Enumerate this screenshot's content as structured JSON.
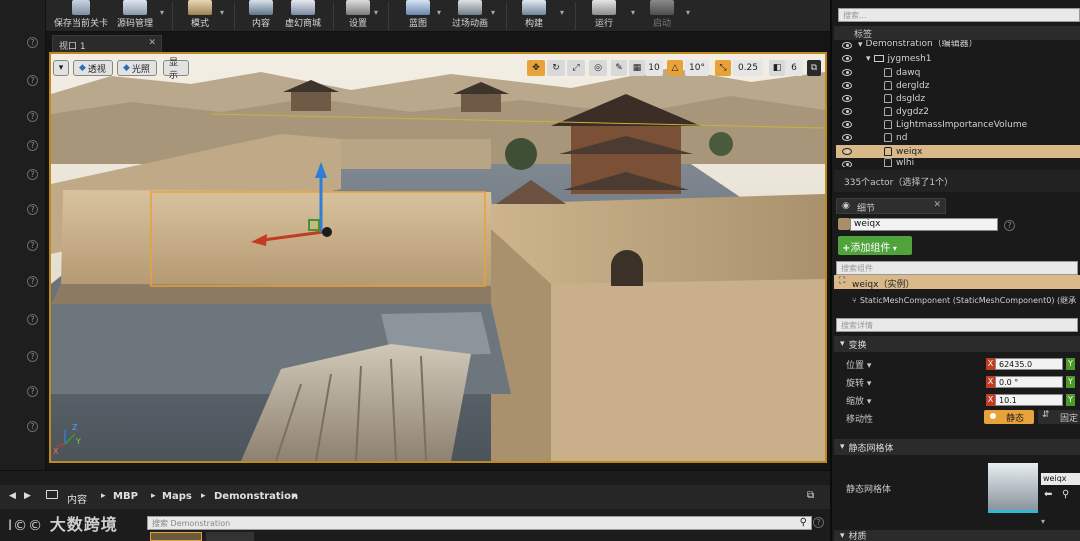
{
  "toolbar": {
    "items": [
      {
        "label": "保存当前关卡",
        "icon": "save-icon"
      },
      {
        "label": "源码管理",
        "icon": "source-control-icon"
      },
      {
        "label": "模式",
        "icon": "modes-icon"
      },
      {
        "label": "内容",
        "icon": "content-icon"
      },
      {
        "label": "虚幻商城",
        "icon": "marketplace-icon"
      },
      {
        "label": "设置",
        "icon": "settings-icon"
      },
      {
        "label": "蓝图",
        "icon": "blueprint-icon"
      },
      {
        "label": "过场动画",
        "icon": "cinematics-icon"
      },
      {
        "label": "构建",
        "icon": "build-icon"
      },
      {
        "label": "运行",
        "icon": "play-icon"
      },
      {
        "label": "启动",
        "icon": "launch-icon"
      }
    ]
  },
  "viewport": {
    "tab_label": "视口 1",
    "perspective_label": "透视",
    "lit_label": "光照",
    "show_label": "显示",
    "grid_snap": "10",
    "rotation_snap": "10°",
    "scale_snap": "0.25",
    "camera_speed": "6",
    "axis_x": "X",
    "axis_y": "Y",
    "axis_z": "Z"
  },
  "breadcrumb": {
    "items": [
      "内容",
      "MBP",
      "Maps",
      "Demonstration"
    ]
  },
  "content_browser": {
    "search_placeholder": "搜索 Demonstration",
    "watermark": "大数跨境"
  },
  "outliner": {
    "search_placeholder": "搜索...",
    "column_label": "标签",
    "root": "Demonstration（编辑器）",
    "folder": "jygmesh1",
    "items": [
      "dawq",
      "dergldz",
      "dsgldz",
      "dygdz2",
      "LightmassImportanceVolume",
      "nd",
      "weiqx",
      "wlhi"
    ],
    "selected": "weiqx",
    "status": "335个actor（选择了1个）"
  },
  "details": {
    "tab_label": "细节",
    "name_value": "weiqx",
    "add_component_label": "添加组件",
    "search_components_placeholder": "搜索组件",
    "instance_label": "weiqx（实例）",
    "component_label": "StaticMeshComponent (StaticMeshComponent0) (继承",
    "search_details_placeholder": "搜索详情",
    "transform_section": "变换",
    "location_label": "位置",
    "rotation_label": "旋转",
    "scale_label": "缩放",
    "mobility_label": "移动性",
    "location_x": "62435.0",
    "rotation_x": "0.0 °",
    "scale_x": "10.1",
    "mobility_static": "静态",
    "mobility_fixed": "固定",
    "static_mesh_section": "静态网格体",
    "static_mesh_label": "静态网格体",
    "static_mesh_value": "weiqx",
    "material_section": "材质"
  },
  "colors": {
    "accent_orange": "#e8a23a",
    "add_green": "#4fa33a",
    "selection_border": "#c08a1a",
    "x_axis": "#c23b22",
    "y_axis": "#4d9a28"
  }
}
